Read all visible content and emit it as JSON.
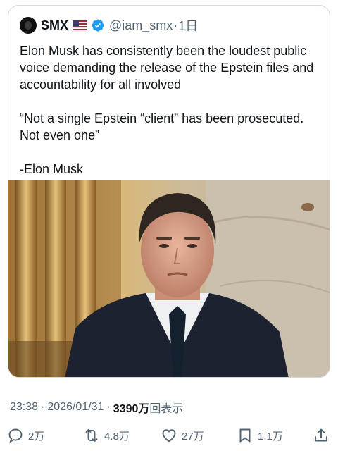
{
  "quoted_post": {
    "display_name": "SMX",
    "flag_icon": "us-flag-emoji",
    "verified_icon": "verified-badge-icon",
    "handle": "@iam_smx",
    "separator": "·",
    "time_ago": "1日",
    "text_lines": [
      "Elon Musk has consistently been the loudest public voice demanding the release of the Epstein files and accountability for all involved",
      "“Not a single Epstein “client” has been prosecuted. Not even one”",
      "-Elon Musk"
    ]
  },
  "post_meta": {
    "time": "23:38",
    "separator": "·",
    "date": "2026/01/31",
    "separator2": "·",
    "views_count": "3390万",
    "views_label": "回表示"
  },
  "actions": {
    "reply_count": "2万",
    "repost_count": "4.8万",
    "like_count": "27万",
    "bookmark_count": "1.1万"
  },
  "colors": {
    "text_primary": "#0f1419",
    "text_secondary": "#536471",
    "border": "#cfd9de",
    "verified_blue": "#1d9bf0"
  }
}
